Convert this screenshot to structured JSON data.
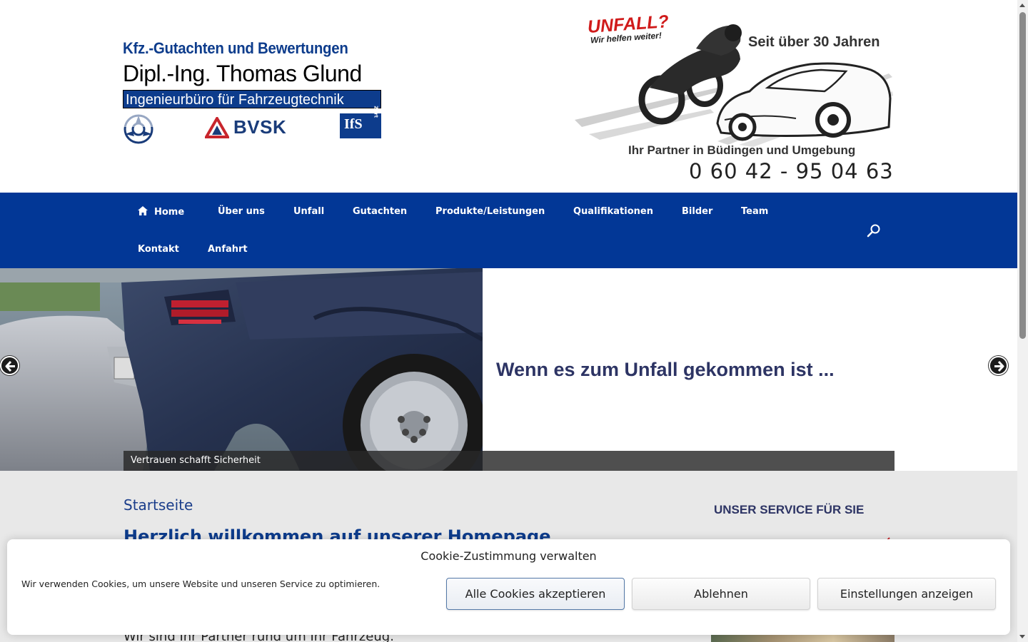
{
  "header": {
    "logo_left": {
      "line1": "Kfz.-Gutachten und Bewertungen",
      "line2": "Dipl.-Ing. Thomas Glund",
      "line3": "Ingenieurbüro für Fahrzeugtechnik",
      "bvsk": "BVSK",
      "ifs": "IfS",
      "ifs_small": "Zert"
    },
    "logo_right": {
      "unfall": "UNFALL?",
      "unfall_sub": "Wir helfen weiter!",
      "seit": "Seit über 30 Jahren",
      "partner": "Ihr Partner in Büdingen und Umgebung",
      "phone": "0 60 42 - 95 04 63"
    }
  },
  "nav": {
    "items": [
      {
        "label": "Home",
        "icon": "home-icon"
      },
      {
        "label": "Über uns"
      },
      {
        "label": "Unfall"
      },
      {
        "label": "Gutachten"
      },
      {
        "label": "Produkte/Leistungen"
      },
      {
        "label": "Qualifikationen"
      },
      {
        "label": "Bilder"
      },
      {
        "label": "Team"
      },
      {
        "label": "Kontakt"
      },
      {
        "label": "Anfahrt"
      }
    ],
    "search_icon": "search-icon",
    "bg_color": "#023796"
  },
  "slider": {
    "heading": "Wenn es zum Unfall gekommen ist ...",
    "caption": "Vertrauen schafft Sicherheit",
    "prev_icon": "arrow-left-icon",
    "next_icon": "arrow-right-icon"
  },
  "content": {
    "breadcrumb": "Startseite",
    "title": "Herzlich willkommen auf unserer Homepage",
    "intro": "Wir sind Ihr Partner rund um Ihr Fahrzeug."
  },
  "sidebar": {
    "heading": "UNSER SERVICE FÜR SIE"
  },
  "cookie": {
    "title": "Cookie-Zustimmung verwalten",
    "text": "Wir verwenden Cookies, um unsere Website und unseren Service zu optimieren.",
    "accept": "Alle Cookies akzeptieren",
    "deny": "Ablehnen",
    "settings": "Einstellungen anzeigen"
  },
  "colors": {
    "brand_blue": "#0d3c8c",
    "nav_blue": "#023796",
    "unfall_red": "#d01b1b"
  }
}
